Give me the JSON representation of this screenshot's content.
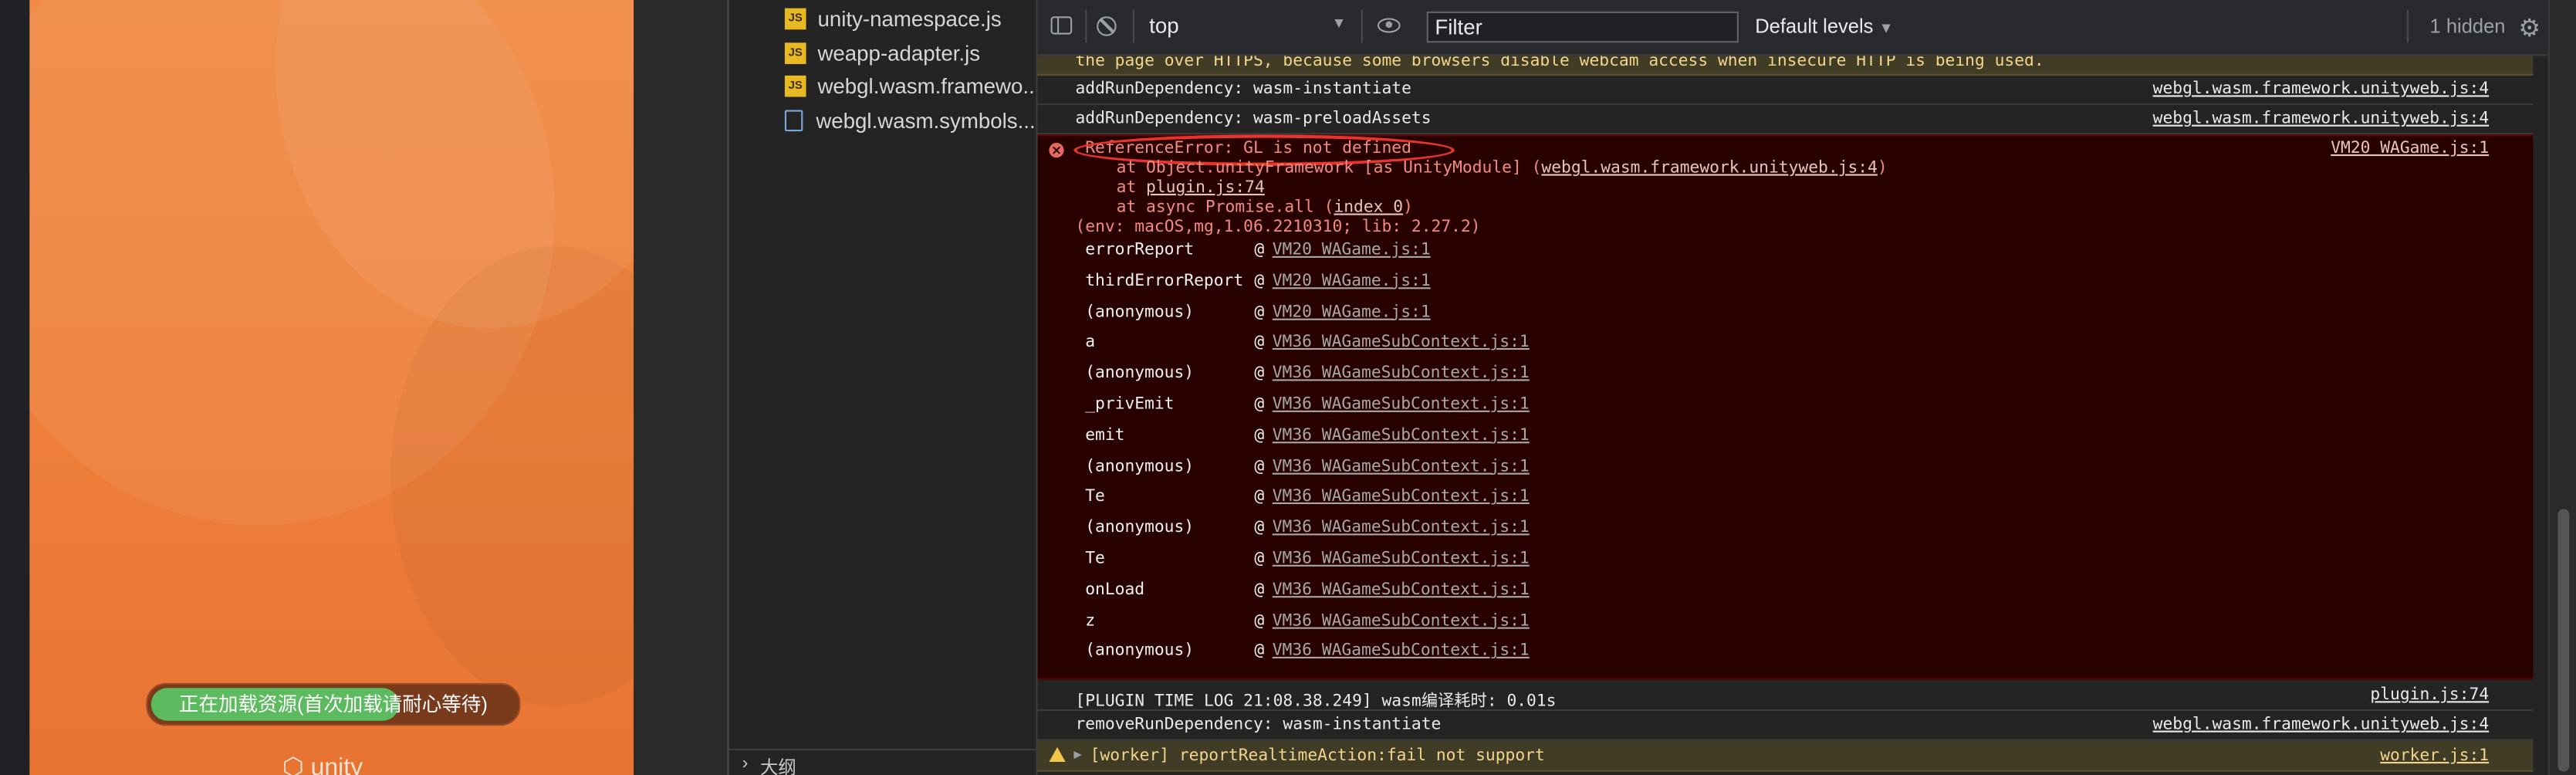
{
  "game": {
    "loading_text": "正在加载资源(首次加载请耐心等待)",
    "loading_progress": 0.68,
    "logo_text": "unity"
  },
  "files": {
    "items": [
      {
        "name": "unity-namespace.js",
        "type": "js"
      },
      {
        "name": "weapp-adapter.js",
        "type": "js"
      },
      {
        "name": "webgl.wasm.framewo...",
        "type": "js"
      },
      {
        "name": "webgl.wasm.symbols....",
        "type": "doc"
      }
    ],
    "outline_label": "大纲"
  },
  "toolbar": {
    "context": "top",
    "filter_placeholder": "Filter",
    "levels": "Default levels",
    "hidden": "1 hidden"
  },
  "console": {
    "warn_top": "the page over HTTPS, because some browsers disable webcam access when insecure HTTP is being used.",
    "messages_before": [
      {
        "text": "addRunDependency:  wasm-instantiate",
        "source": "webgl.wasm.framework.unityweb.js:4"
      },
      {
        "text": "addRunDependency:  wasm-preloadAssets",
        "source": "webgl.wasm.framework.unityweb.js:4"
      }
    ],
    "error": {
      "message": "ReferenceError: GL is not defined",
      "source": "VM20 WAGame.js:1",
      "line2_prefix": "at Object.unityFramework [as UnityModule] (",
      "line2_link": "webgl.wasm.framework.unityweb.js:4",
      "line2_suffix": ")",
      "line3_prefix": "at ",
      "line3_link": "plugin.js:74",
      "line4_prefix": "at async Promise.all (",
      "line4_link": "index 0",
      "line4_suffix": ")",
      "env": "(env: macOS,mg,1.06.2210310; lib: 2.27.2)",
      "stack": [
        {
          "fn": "errorReport",
          "loc": "VM20 WAGame.js:1"
        },
        {
          "fn": "thirdErrorReport",
          "loc": "VM20 WAGame.js:1"
        },
        {
          "fn": "(anonymous)",
          "loc": "VM20 WAGame.js:1"
        },
        {
          "fn": "a",
          "loc": "VM36 WAGameSubContext.js:1"
        },
        {
          "fn": "(anonymous)",
          "loc": "VM36 WAGameSubContext.js:1"
        },
        {
          "fn": "_privEmit",
          "loc": "VM36 WAGameSubContext.js:1"
        },
        {
          "fn": "emit",
          "loc": "VM36 WAGameSubContext.js:1"
        },
        {
          "fn": "(anonymous)",
          "loc": "VM36 WAGameSubContext.js:1"
        },
        {
          "fn": "Te",
          "loc": "VM36 WAGameSubContext.js:1"
        },
        {
          "fn": "(anonymous)",
          "loc": "VM36 WAGameSubContext.js:1"
        },
        {
          "fn": "Te",
          "loc": "VM36 WAGameSubContext.js:1"
        },
        {
          "fn": "onLoad",
          "loc": "VM36 WAGameSubContext.js:1"
        },
        {
          "fn": "z",
          "loc": "VM36 WAGameSubContext.js:1"
        },
        {
          "fn": "(anonymous)",
          "loc": "VM36 WAGameSubContext.js:1"
        }
      ],
      "at_symbol": "@"
    },
    "messages_after": [
      {
        "text": "[PLUGIN TIME LOG 21:08.38.249] wasm编译耗时: 0.01s",
        "source": "plugin.js:74"
      },
      {
        "text": "removeRunDependency:  wasm-instantiate",
        "source": "webgl.wasm.framework.unityweb.js:4"
      }
    ],
    "warn_bottom": {
      "text": "[worker] reportRealtimeAction:fail not support",
      "source": "worker.js:1"
    }
  },
  "colors": {
    "error_bg": "#290000",
    "error_text": "#f28b82",
    "warning_bg": "#413c26",
    "accent_green": "#5cbb5e",
    "game_orange": "#ee7f3a",
    "annotation_red": "#e8352b"
  }
}
